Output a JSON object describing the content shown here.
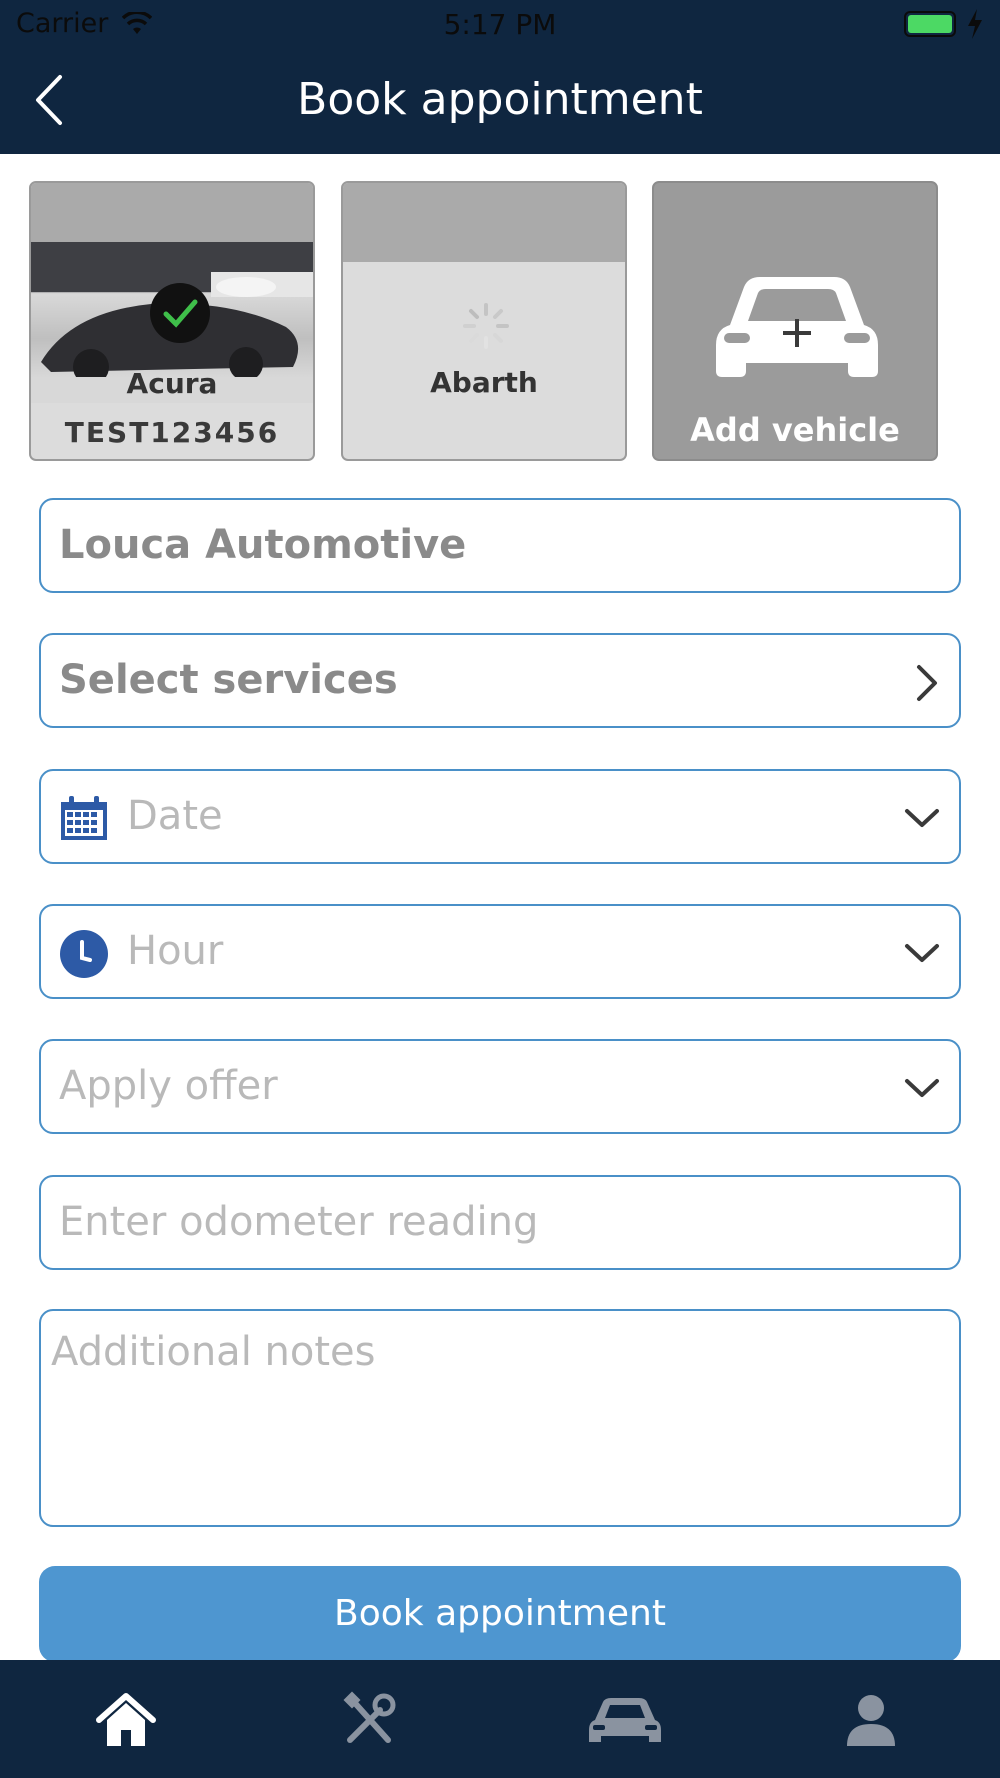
{
  "status_bar": {
    "carrier": "Carrier",
    "time": "5:17 PM",
    "battery_color": "#4cd964"
  },
  "nav": {
    "title": "Book appointment",
    "back_icon": "chevron-left-icon"
  },
  "vehicles": [
    {
      "make": "Acura",
      "plate": "TEST123456",
      "selected": true,
      "icon": "checkmark-icon"
    },
    {
      "make": "Abarth",
      "loading": true,
      "icon": "spinner-icon"
    },
    {
      "label": "Add vehicle",
      "icon": "car-plus-icon"
    }
  ],
  "form": {
    "shop": "Louca Automotive",
    "services": "Select services",
    "date_placeholder": "Date",
    "hour_placeholder": "Hour",
    "offer_placeholder": "Apply offer",
    "odometer_placeholder": "Enter odometer reading",
    "notes_placeholder": "Additional notes"
  },
  "submit_label": "Book appointment",
  "tabbar": {
    "items": [
      {
        "name": "home",
        "icon": "home-icon",
        "active": true
      },
      {
        "name": "services",
        "icon": "tools-icon"
      },
      {
        "name": "vehicles",
        "icon": "car-icon"
      },
      {
        "name": "profile",
        "icon": "user-icon"
      }
    ]
  },
  "colors": {
    "nav_bg": "#0f2640",
    "field_border": "#4a90c8",
    "button_bg": "#4e96d0",
    "icon_blue": "#2d5aa6"
  }
}
